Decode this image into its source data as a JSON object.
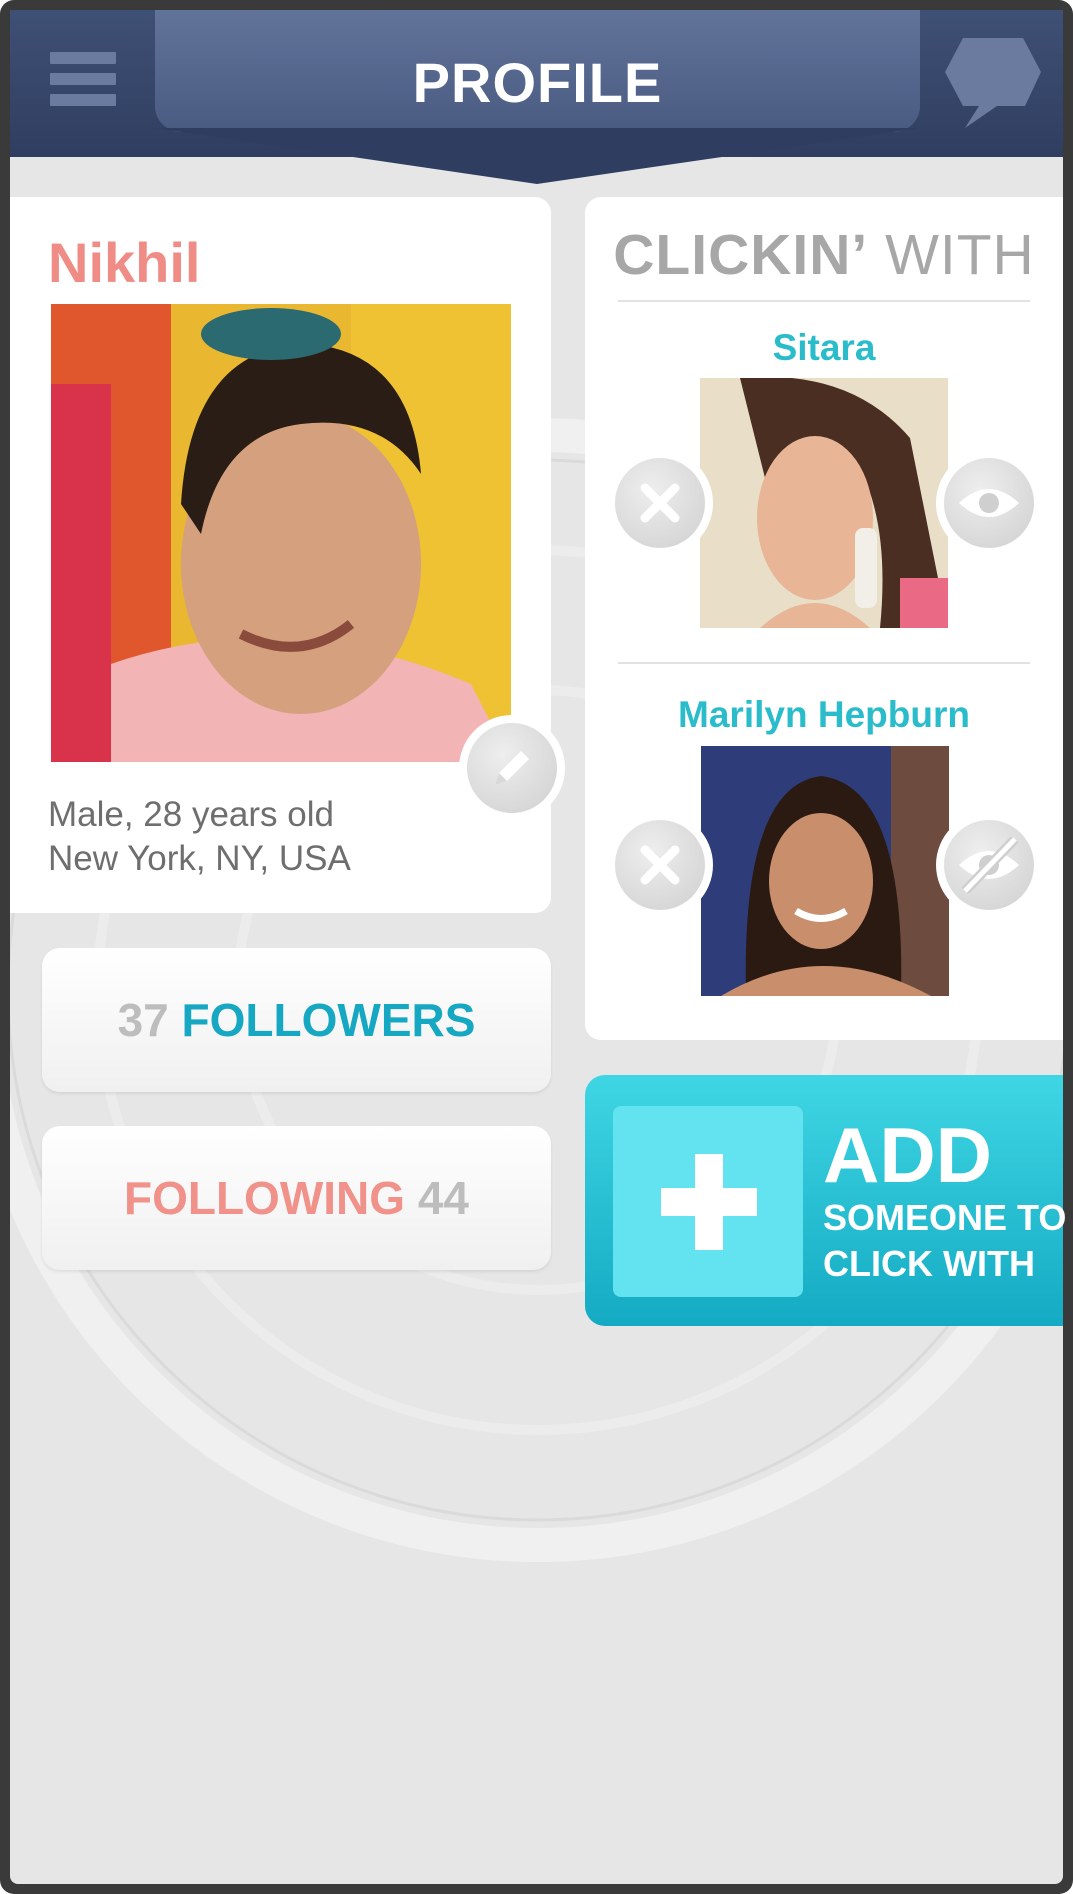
{
  "header": {
    "title": "PROFILE",
    "menu_icon": "hamburger-menu-icon",
    "chat_icon": "speech-bubble-icon",
    "colors": {
      "bar": "#2f3e60",
      "tab": "#55668d"
    }
  },
  "profile": {
    "name": "Nikhil",
    "details_line1": "Male, 28 years old",
    "details_line2": "New York, NY, USA",
    "edit_icon": "pencil-icon",
    "name_color": "#f08c86"
  },
  "stats": {
    "followers_count": "37",
    "followers_label": "FOLLOWERS",
    "following_label": "FOLLOWING",
    "following_count": "44"
  },
  "clickin": {
    "heading_bold": "CLICKIN’",
    "heading_light": "WITH",
    "matches": [
      {
        "name": "Sitara",
        "remove_icon": "close-x-icon",
        "visibility_icon": "eye-icon"
      },
      {
        "name": "Marilyn Hepburn",
        "remove_icon": "close-x-icon",
        "visibility_icon": "eye-slash-icon"
      }
    ]
  },
  "add_button": {
    "line1": "ADD",
    "line2": "SOMEONE TO",
    "line3": "CLICK WITH",
    "icon": "plus-icon",
    "color": "#14aac3"
  }
}
